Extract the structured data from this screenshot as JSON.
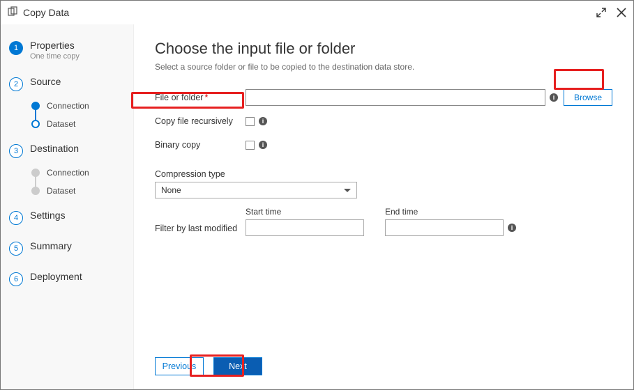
{
  "window": {
    "title": "Copy Data"
  },
  "sidebar": {
    "steps": [
      {
        "num": "1",
        "label": "Properties",
        "sub": "One time copy"
      },
      {
        "num": "2",
        "label": "Source"
      },
      {
        "num": "3",
        "label": "Destination"
      },
      {
        "num": "4",
        "label": "Settings"
      },
      {
        "num": "5",
        "label": "Summary"
      },
      {
        "num": "6",
        "label": "Deployment"
      }
    ],
    "source_substeps": [
      "Connection",
      "Dataset"
    ],
    "dest_substeps": [
      "Connection",
      "Dataset"
    ]
  },
  "main": {
    "heading": "Choose the input file or folder",
    "subheading": "Select a source folder or file to be copied to the destination data store.",
    "file_or_folder_label": "File or folder",
    "browse_label": "Browse",
    "copy_recursive_label": "Copy file recursively",
    "binary_copy_label": "Binary copy",
    "compression_label": "Compression type",
    "compression_value": "None",
    "filter_label": "Filter by last modified",
    "start_time_label": "Start time",
    "end_time_label": "End time"
  },
  "footer": {
    "previous": "Previous",
    "next": "Next"
  }
}
